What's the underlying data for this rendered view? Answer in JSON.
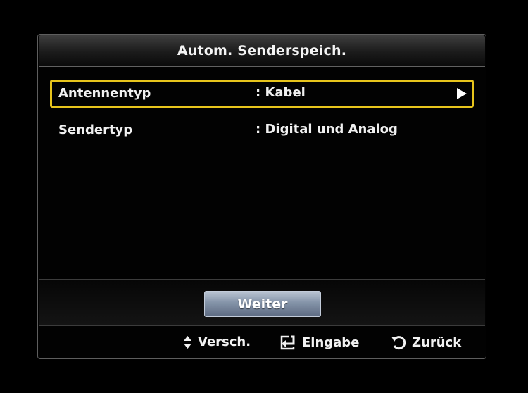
{
  "dialog": {
    "title": "Autom. Senderspeich."
  },
  "menu": {
    "items": [
      {
        "label": "Antennentyp",
        "value": ": Kabel",
        "selected": true
      },
      {
        "label": "Sendertyp",
        "value": ": Digital und Analog",
        "selected": false
      }
    ]
  },
  "actions": {
    "next_label": "Weiter"
  },
  "footer": {
    "move_label": "Versch.",
    "enter_label": "Eingabe",
    "back_label": "Zurück"
  },
  "colors": {
    "selection_border": "#e7c41c",
    "button_gradient_top": "#b9c4d2",
    "button_gradient_bottom": "#5e6c83",
    "background": "#000000"
  },
  "icons": [
    "arrow-right-icon",
    "up-down-icon",
    "enter-icon",
    "return-icon"
  ]
}
